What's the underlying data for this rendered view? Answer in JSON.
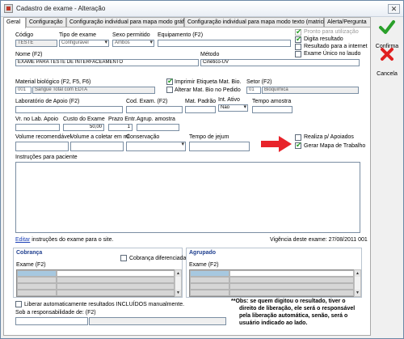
{
  "window": {
    "title": "Cadastro de exame - Alteração",
    "close_glyph": "✕"
  },
  "tabs": [
    {
      "label": "Geral"
    },
    {
      "label": "Configuração"
    },
    {
      "label": "Configuração individual para mapa modo gráfico"
    },
    {
      "label": "Configuração individual para mapa modo texto (matricial)"
    },
    {
      "label": "Alerta/Pergunta"
    }
  ],
  "actions": {
    "confirm_label": "Confirma",
    "cancel_label": "Cancela"
  },
  "form": {
    "codigo": {
      "label": "Código",
      "value": "TESTE"
    },
    "tipo_exame": {
      "label": "Tipo de exame",
      "value": "Configurável"
    },
    "sexo": {
      "label": "Sexo permitido",
      "value": "Ambos"
    },
    "equipamento": {
      "label": "Equipamento (F2)",
      "value": ""
    },
    "pronto_uso": {
      "label": "Pronto para utilização",
      "checked": true
    },
    "digita_resultado": {
      "label": "Digita resultado",
      "checked": true
    },
    "resultado_internet": {
      "label": "Resultado para a internet",
      "checked": false
    },
    "exame_unico": {
      "label": "Exame Único no laudo",
      "checked": false
    },
    "nome": {
      "label": "Nome (F2)",
      "value": "EXAME PARA TESTE DE INTERFACEAMENTO"
    },
    "metodo": {
      "label": "Método",
      "value": "Cinético-UV"
    },
    "material": {
      "label": "Material biológico (F2, F5, F6)",
      "code": "001",
      "value": "Sangue Total com EDTA"
    },
    "imprimir_etiqueta": {
      "label": "Imprimir Etiqueta Mat. Bio.",
      "checked": true
    },
    "alterar_mat": {
      "label": "Alterar Mat. Bio no Pedido",
      "checked": false
    },
    "setor": {
      "label": "Setor (F2)",
      "code": "01",
      "value": "Bioquímica"
    },
    "laboratorio_apoio": {
      "label": "Laboratório de Apoio (F2)",
      "value": ""
    },
    "cod_exam": {
      "label": "Cod. Exam. (F2)",
      "value": ""
    },
    "mat_padrao": {
      "label": "Mat. Padrão",
      "value": ""
    },
    "int_ativo": {
      "label": "Int. Ativo",
      "value": "Não"
    },
    "tempo_amostra": {
      "label": "Tempo amostra",
      "value": ""
    },
    "vr_lab_apoio": {
      "label": "Vr. no Lab. Apoio",
      "value": ""
    },
    "custo_exame": {
      "label": "Custo do Exame",
      "value": "50,00"
    },
    "prazo_entr": {
      "label": "Prazo Entr.",
      "value": "1"
    },
    "agrup_amostra": {
      "label": "Agrup. amostra",
      "value": ""
    },
    "volume_recomendavel": {
      "label": "Volume recomendável",
      "value": ""
    },
    "volume_coletar": {
      "label": "Volume a coletar em ml",
      "value": ""
    },
    "conservacao": {
      "label": "Conservação",
      "value": ""
    },
    "tempo_jejum": {
      "label": "Tempo de jejum",
      "value": ""
    },
    "realiza_apoiados": {
      "label": "Realiza p/ Apoiados",
      "checked": false
    },
    "gerar_mapa": {
      "label": "Gerar Mapa de Trabalho",
      "checked": true
    },
    "instrucoes": {
      "label": "Instruções para paciente",
      "value": ""
    },
    "editar_link": "Editar",
    "editar_text": " instruções do exame para o site.",
    "vigencia": "Vigência deste exame: 27/08/2011 001"
  },
  "cobranca": {
    "title": "Cobrança",
    "diferenciada_label": "Cobrança diferenciada",
    "diferenciada_checked": false,
    "exame_label": "Exame (F2)"
  },
  "agrupado": {
    "title": "Agrupado",
    "exame_label": "Exame (F2)"
  },
  "footer": {
    "liberar_label": "Liberar automaticamente resultados INCLUÍDOS manualmente.",
    "liberar_checked": false,
    "responsabilidade_label": "Sob a responsabilidade de: (F2)",
    "responsabilidade_value": "",
    "obs": [
      "**Obs: se quem digitou o resultado, tiver o",
      "direito de liberação, ele será o responsável",
      "pela liberação automática, senão, será o",
      "usuário indicado ao lado."
    ]
  },
  "colors": {
    "accent_link": "#1a3fb5",
    "group_title": "#1f3f8f",
    "arrow": "#e8232a",
    "check": "#2aa02a"
  }
}
